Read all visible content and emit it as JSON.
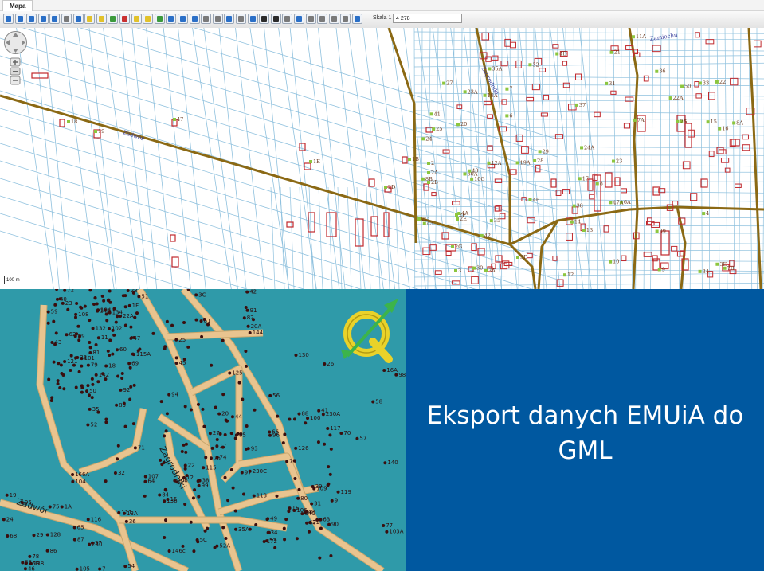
{
  "window": {
    "tab_label": "Mapa"
  },
  "toolbar": {
    "scale_label": "Skala 1 :",
    "scale_value": "4 278",
    "colors": {
      "blue": "#2a6fc7",
      "green": "#3c9a3c",
      "red": "#c93030",
      "yellow": "#e2c22b",
      "gray": "#7a7a7a",
      "dark": "#2b2b2b"
    },
    "tools": [
      {
        "name": "pan-tool-icon",
        "color": "blue"
      },
      {
        "name": "zoom-in-tool-icon",
        "color": "blue"
      },
      {
        "name": "zoom-out-tool-icon",
        "color": "blue"
      },
      {
        "name": "zoom-box-icon",
        "color": "blue"
      },
      {
        "name": "zoom-extent-icon",
        "color": "blue"
      },
      {
        "name": "print-icon",
        "color": "gray"
      },
      {
        "name": "table-icon",
        "color": "blue"
      },
      {
        "name": "pencil-icon",
        "color": "yellow"
      },
      {
        "name": "select-icon",
        "color": "yellow"
      },
      {
        "name": "edit-icon",
        "color": "green"
      },
      {
        "name": "target-icon",
        "color": "red"
      },
      {
        "name": "measure-icon",
        "color": "yellow"
      },
      {
        "name": "label-icon",
        "color": "yellow"
      },
      {
        "name": "layer-icon",
        "color": "green"
      },
      {
        "name": "export-icon",
        "color": "blue"
      },
      {
        "name": "import-icon",
        "color": "blue"
      },
      {
        "name": "download-icon",
        "color": "blue"
      },
      {
        "name": "document-icon",
        "color": "gray"
      },
      {
        "name": "list-icon",
        "color": "gray"
      },
      {
        "name": "grid-icon",
        "color": "blue"
      },
      {
        "name": "printer-icon",
        "color": "gray"
      },
      {
        "name": "user-icon",
        "color": "blue"
      },
      {
        "name": "truck-icon",
        "color": "dark"
      },
      {
        "name": "vehicle-icon",
        "color": "dark"
      },
      {
        "name": "note-icon",
        "color": "gray"
      },
      {
        "name": "layers-icon",
        "color": "blue"
      },
      {
        "name": "window-icon",
        "color": "gray"
      },
      {
        "name": "panel-icon",
        "color": "gray"
      },
      {
        "name": "report-icon",
        "color": "gray"
      },
      {
        "name": "info-icon",
        "color": "gray"
      },
      {
        "name": "map-icon",
        "color": "blue"
      }
    ]
  },
  "cadastral_map": {
    "scale_bar_label": "100 m",
    "colors": {
      "parcel_line": "#8fc1de",
      "road": "#8b6914",
      "building": "#c0282d",
      "point": "#8dc63f",
      "label": "#6b3a1f",
      "road_label": "#3b3f9c"
    },
    "street_labels": [
      "Zadwór",
      "Zagrodniki",
      "Zamiechu"
    ],
    "parcel_labels": [
      "18",
      "19",
      "47",
      "1E",
      "1B",
      "2",
      "2A",
      "2B",
      "2C",
      "2D",
      "2E",
      "2F",
      "2G",
      "3",
      "3A",
      "3D",
      "3E",
      "4",
      "4A",
      "4B",
      "4D",
      "5",
      "6",
      "6A",
      "7",
      "7A",
      "7B",
      "8",
      "8A",
      "8B",
      "9",
      "10",
      "10G",
      "11A",
      "12",
      "12A",
      "13",
      "14",
      "15",
      "16",
      "17",
      "18A",
      "19A",
      "20",
      "21",
      "22",
      "22A",
      "23",
      "23A",
      "24",
      "24A",
      "25",
      "26",
      "27",
      "28",
      "29",
      "30",
      "30A",
      "31",
      "32",
      "33",
      "34",
      "35",
      "35A",
      "36",
      "37",
      "38",
      "39",
      "40",
      "41",
      "42",
      "43",
      "47A",
      "50"
    ]
  },
  "vector_map": {
    "colors": {
      "background": "#2f9aa9",
      "road": "#e9c48f",
      "road_edge": "#c9a66c",
      "point": "#3a0e0e",
      "label": "#2a0a0a",
      "logo_yellow": "#e9d22a",
      "logo_green": "#3cb44a"
    },
    "street_labels": [
      "Zadwór",
      "Zagrodniki"
    ],
    "point_labels": [
      "59",
      "18",
      "117",
      "116",
      "58",
      "115A",
      "115",
      "113",
      "105",
      "103A",
      "101",
      "99",
      "97",
      "104",
      "106",
      "108",
      "230C",
      "230A",
      "230",
      "49",
      "47",
      "45",
      "38",
      "13A",
      "16A",
      "14A",
      "20",
      "22",
      "24",
      "26",
      "28",
      "32",
      "34",
      "36",
      "41",
      "43",
      "51",
      "53",
      "55",
      "57",
      "62",
      "64",
      "66",
      "68",
      "70",
      "72",
      "74",
      "76",
      "78",
      "80",
      "81",
      "83",
      "85",
      "87",
      "88",
      "89",
      "91",
      "93",
      "95",
      "100",
      "102",
      "107",
      "109",
      "111",
      "119",
      "121",
      "125",
      "126",
      "128",
      "130",
      "132",
      "134",
      "136",
      "138",
      "140",
      "142",
      "144",
      "146c",
      "166A",
      "172",
      "194",
      "206",
      "15",
      "1A",
      "1E",
      "1F",
      "3C",
      "5C",
      "7",
      "9",
      "11",
      "12",
      "17",
      "19",
      "21",
      "23",
      "25",
      "27",
      "29",
      "31",
      "33",
      "35",
      "35A",
      "37",
      "39",
      "40",
      "42",
      "44",
      "46",
      "48",
      "50",
      "52",
      "52A",
      "54",
      "56",
      "60",
      "61",
      "63",
      "65",
      "67",
      "69",
      "71",
      "73",
      "75",
      "77",
      "79",
      "82",
      "84",
      "86",
      "90",
      "92",
      "94",
      "96",
      "96B",
      "98",
      "22A",
      "20A",
      "64C"
    ]
  },
  "slide": {
    "title_line1": "Eksport danych EMUiA do",
    "title_line2": "GML"
  }
}
